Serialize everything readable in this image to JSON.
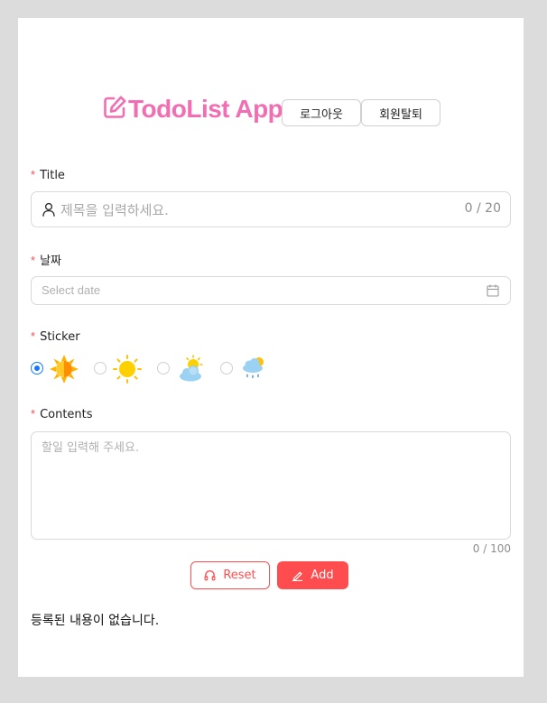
{
  "header": {
    "app_title": "TodoList App",
    "logout_label": "로그아웃",
    "withdraw_label": "회원탈퇴",
    "logo_icon": "edit-square-icon",
    "brand_color": "#f06eb1"
  },
  "form": {
    "title": {
      "required_mark": "*",
      "label": "Title",
      "placeholder": "제목을 입력하세요.",
      "count": "0 / 20",
      "icon": "user-icon"
    },
    "date": {
      "required_mark": "*",
      "label": "날짜",
      "placeholder": "Select date",
      "icon": "calendar-icon"
    },
    "sticker": {
      "required_mark": "*",
      "label": "Sticker",
      "options": [
        {
          "name": "sunny-hot-sticker",
          "selected": true
        },
        {
          "name": "sunny-sticker",
          "selected": false
        },
        {
          "name": "partly-cloudy-sticker",
          "selected": false
        },
        {
          "name": "rainy-sticker",
          "selected": false
        }
      ]
    },
    "contents": {
      "required_mark": "*",
      "label": "Contents",
      "placeholder": "할일 입력해 주세요.",
      "count": "0 / 100"
    }
  },
  "actions": {
    "reset_label": "Reset",
    "add_label": "Add",
    "reset_icon": "reset-icon",
    "add_icon": "edit-icon"
  },
  "list": {
    "empty_message": "등록된 내용이 없습니다."
  },
  "colors": {
    "accent": "#1677ff",
    "danger": "#ff4d4f",
    "brand": "#f06eb1"
  }
}
